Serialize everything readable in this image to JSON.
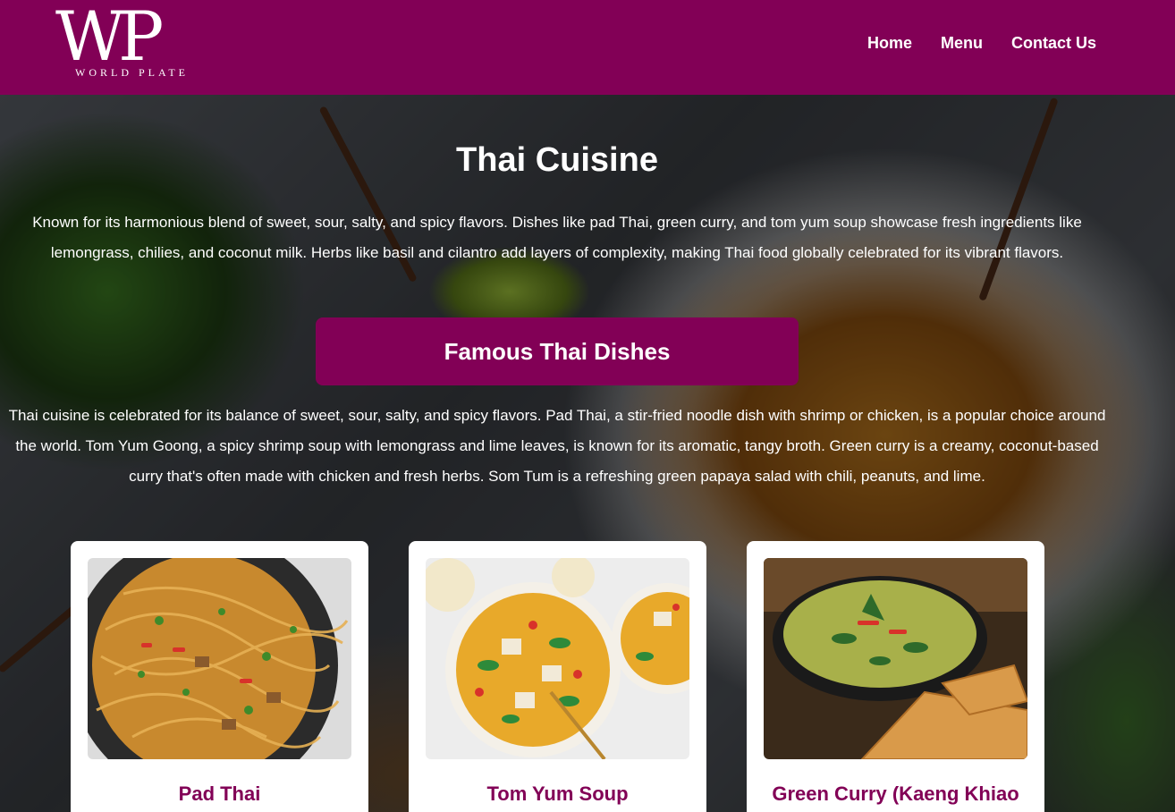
{
  "logo": {
    "mark": "WP",
    "sub": "WORLD PLATE"
  },
  "nav": {
    "items": [
      "Home",
      "Menu",
      "Contact Us"
    ]
  },
  "page": {
    "title": "Thai Cuisine",
    "intro": "Known for its harmonious blend of sweet, sour, salty, and spicy flavors. Dishes like pad Thai, green curry, and tom yum soup showcase fresh ingredients like lemongrass, chilies, and coconut milk. Herbs like basil and cilantro add layers of complexity, making Thai food globally celebrated for its vibrant flavors."
  },
  "section": {
    "title": "Famous Thai Dishes",
    "text": "Thai cuisine is celebrated for its balance of sweet, sour, salty, and spicy flavors. Pad Thai, a stir-fried noodle dish with shrimp or chicken, is a popular choice around the world. Tom Yum Goong, a spicy shrimp soup with lemongrass and lime leaves, is known for its aromatic, tangy broth. Green curry is a creamy, coconut-based curry that's often made with chicken and fresh herbs. Som Tum is a refreshing green papaya salad with chili, peanuts, and lime."
  },
  "cards": [
    {
      "title": "Pad Thai"
    },
    {
      "title": "Tom Yum Soup"
    },
    {
      "title": "Green Curry (Kaeng Khiao Wan)"
    }
  ],
  "colors": {
    "brand": "#820056",
    "text_light": "#ffffff"
  }
}
